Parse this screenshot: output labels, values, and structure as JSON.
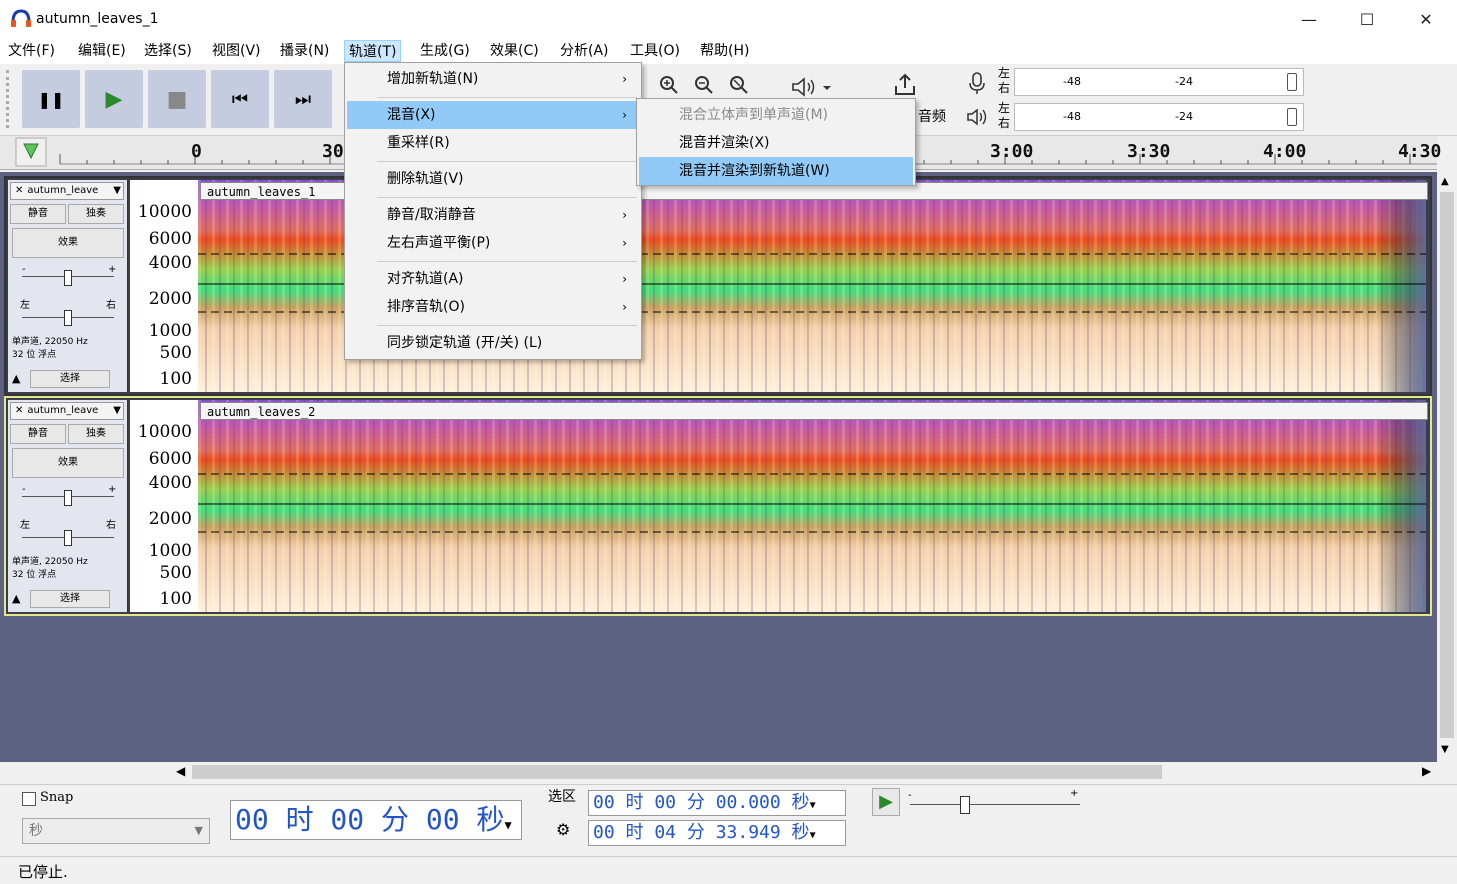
{
  "window": {
    "title": "autumn_leaves_1",
    "minimize": "—",
    "maximize": "☐",
    "close": "✕"
  },
  "menubar": [
    "文件(F)",
    "编辑(E)",
    "选择(S)",
    "视图(V)",
    "播录(N)",
    "轨道(T)",
    "生成(G)",
    "效果(C)",
    "分析(A)",
    "工具(O)",
    "帮助(H)"
  ],
  "transport": {
    "pause": "❚❚",
    "play": "▶",
    "stop": "■",
    "skip_start": "⏮",
    "skip_end": "⏭"
  },
  "meters": {
    "record_channels": [
      "左",
      "右"
    ],
    "play_channels": [
      "左",
      "右"
    ],
    "ticks": [
      "-48",
      "-24"
    ]
  },
  "audio_setup_label": "音频",
  "ruler": {
    "labels": [
      "0",
      "30",
      "3:00",
      "3:30",
      "4:00",
      "4:30"
    ]
  },
  "tracks": [
    {
      "name": "autumn_leave",
      "clip_name": "autumn_leaves_1",
      "mute": "静音",
      "solo": "独奏",
      "effects": "效果",
      "pan_left": "左",
      "pan_right": "右",
      "info_line1": "单声道, 22050 Hz",
      "info_line2": "32 位 浮点",
      "select": "选择",
      "scale": [
        "10000",
        "6000",
        "4000",
        "2000",
        "1000",
        "500",
        "100"
      ]
    },
    {
      "name": "autumn_leave",
      "clip_name": "autumn_leaves_2",
      "mute": "静音",
      "solo": "独奏",
      "effects": "效果",
      "pan_left": "左",
      "pan_right": "右",
      "info_line1": "单声道, 22050 Hz",
      "info_line2": "32 位 浮点",
      "select": "选择",
      "scale": [
        "10000",
        "6000",
        "4000",
        "2000",
        "1000",
        "500",
        "100"
      ]
    }
  ],
  "track_menu": {
    "items": [
      {
        "label": "增加新轨道(N)",
        "submenu": true
      },
      {
        "label": "混音(X)",
        "submenu": true,
        "highlighted": true
      },
      {
        "label": "重采样(R)",
        "submenu": false
      },
      {
        "label": "删除轨道(V)",
        "submenu": false
      },
      {
        "label": "静音/取消静音",
        "submenu": true
      },
      {
        "label": "左右声道平衡(P)",
        "submenu": true
      },
      {
        "label": "对齐轨道(A)",
        "submenu": true
      },
      {
        "label": "排序音轨(O)",
        "submenu": true
      },
      {
        "label": "同步锁定轨道 (开/关) (L)",
        "submenu": false
      }
    ]
  },
  "mix_submenu": {
    "items": [
      {
        "label": "混合立体声到单声道(M)",
        "disabled": true
      },
      {
        "label": "混音并渲染(X)",
        "disabled": false
      },
      {
        "label": "混音并渲染到新轨道(W)",
        "disabled": false,
        "highlighted": true
      }
    ]
  },
  "bottom": {
    "snap_label": "Snap",
    "snap_unit": "秒",
    "position_time": "00 时 00 分 00 秒",
    "selection_label": "选区",
    "sel_start": "00 时 00 分 00.000 秒",
    "sel_end": "00 时 04 分 33.949 秒"
  },
  "status": "已停止.",
  "colors": {
    "menu_highlight": "#91c9f7",
    "transport_button": "#c6cce0",
    "track_background": "#5d6282",
    "selected_track_border": "#e6e68a",
    "time_digits": "#2255cc"
  }
}
